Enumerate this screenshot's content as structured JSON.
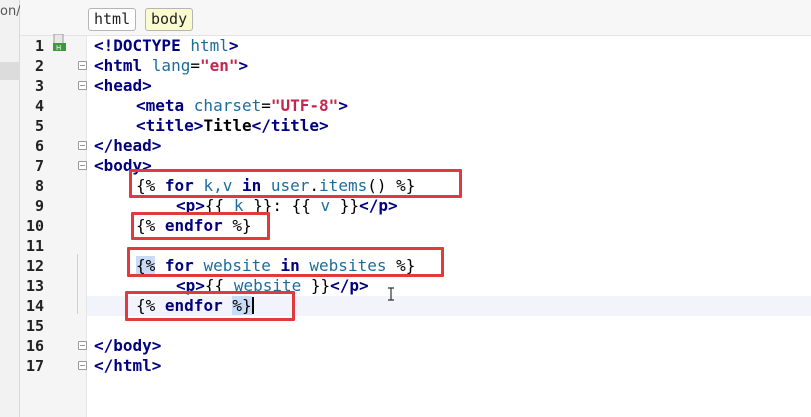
{
  "side_panel": {
    "crumb": "on/"
  },
  "breadcrumb": {
    "items": [
      "html",
      "body"
    ]
  },
  "gutter": {
    "line_numbers": [
      "1",
      "2",
      "3",
      "4",
      "5",
      "6",
      "7",
      "8",
      "9",
      "10",
      "11",
      "12",
      "13",
      "14",
      "15",
      "16",
      "17"
    ]
  },
  "code": {
    "l1": {
      "a": "<!DOCTYPE ",
      "b": "html",
      "c": ">"
    },
    "l2": {
      "a": "<html ",
      "b": "lang",
      "c": "=",
      "d": "\"en\"",
      "e": ">"
    },
    "l3": {
      "a": "<head>"
    },
    "l4": {
      "a": "<meta ",
      "b": "charset",
      "c": "=",
      "d": "\"UTF-8\"",
      "e": ">"
    },
    "l5": {
      "a": "<title>",
      "b": "Title",
      "c": "</title>"
    },
    "l6": {
      "a": "</head>"
    },
    "l7": {
      "a": "<body>"
    },
    "l8": {
      "a": "{% ",
      "b": "for ",
      "c": "k,v ",
      "d": "in ",
      "e": "user",
      "f": ".",
      "g": "items",
      "h": "() %}"
    },
    "l9": {
      "a": "<p>",
      "b": "{{ ",
      "c": "k",
      "d": " }}",
      "e": ": ",
      "f": "{{ ",
      "g": "v",
      "h": " }}",
      "i": "</p>"
    },
    "l10": {
      "a": "{% ",
      "b": "endfor",
      "c": " %}"
    },
    "l12": {
      "a": "{%",
      "b": " for ",
      "c": "website ",
      "d": "in ",
      "e": "websites",
      "f": " %}"
    },
    "l13": {
      "a": "<p>",
      "b": "{{ ",
      "c": "website",
      "d": " }}",
      "e": "</p>"
    },
    "l14": {
      "a": "{% ",
      "b": "endfor",
      "c": " ",
      "d": "%}"
    },
    "l16": {
      "a": "</body>"
    },
    "l17": {
      "a": "</html>"
    }
  },
  "colors": {
    "annotation_box": "#e03a3e",
    "tag_keyword": "#000080",
    "string": "#c7254e",
    "attribute": "#1b6d9e"
  },
  "icons": [
    "html-file-icon",
    "lightbulb-icon",
    "text-cursor-icon"
  ]
}
